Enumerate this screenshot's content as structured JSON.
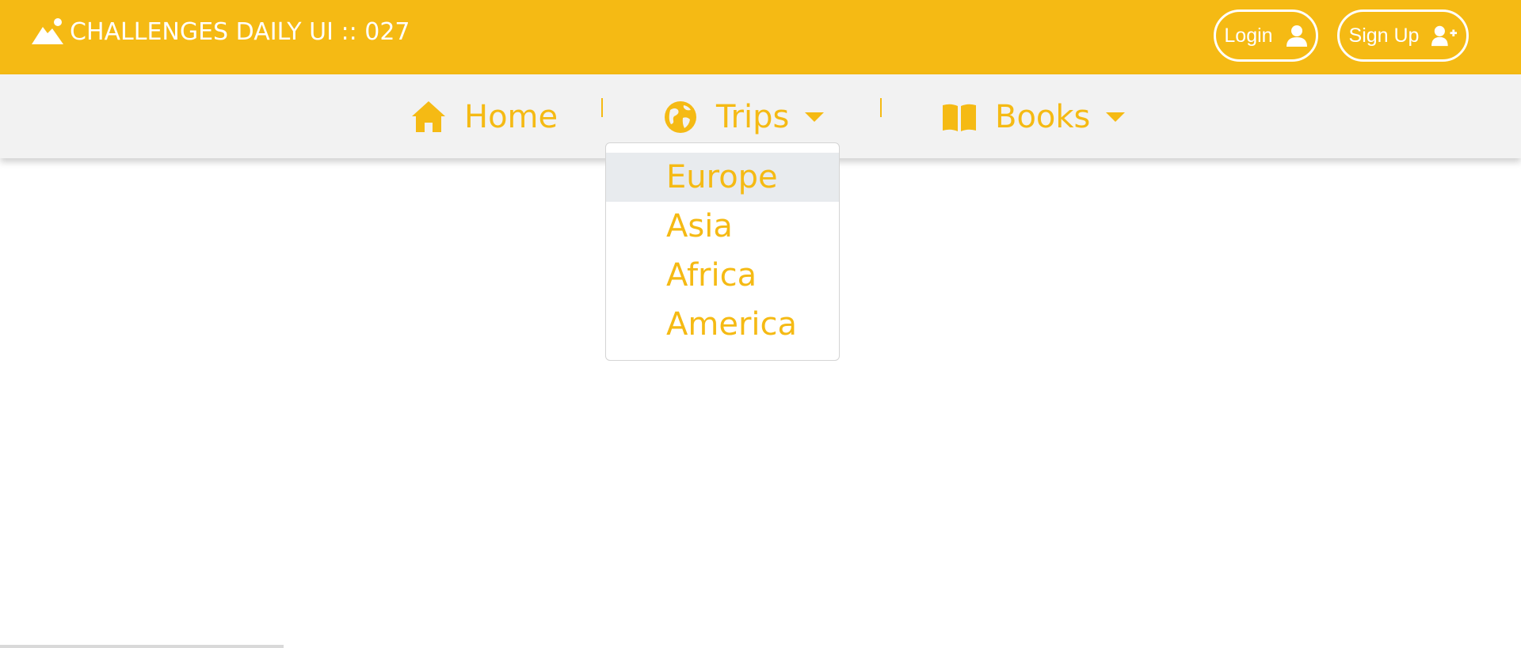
{
  "header": {
    "brand_icon": "mountain-icon",
    "title": "CHALLENGES DAILY UI :: 027",
    "login_label": "Login",
    "login_icon": "user-icon",
    "signup_label": "Sign Up",
    "signup_icon": "user-plus-icon"
  },
  "nav": {
    "items": [
      {
        "label": "Home",
        "icon": "home-icon"
      },
      {
        "label": "Trips",
        "icon": "globe-icon",
        "has_dropdown": true
      },
      {
        "label": "Books",
        "icon": "book-open-icon",
        "has_dropdown": true
      }
    ]
  },
  "dropdown": {
    "open_for": "Trips",
    "items": [
      {
        "label": "Europe",
        "highlighted": true
      },
      {
        "label": "Asia"
      },
      {
        "label": "Africa"
      },
      {
        "label": "America"
      }
    ]
  },
  "colors": {
    "accent": "#f5ba14",
    "navbar_bg": "#f2f2f2",
    "dropdown_hover_bg": "#e8ebee",
    "text_on_accent": "#ffffff"
  }
}
